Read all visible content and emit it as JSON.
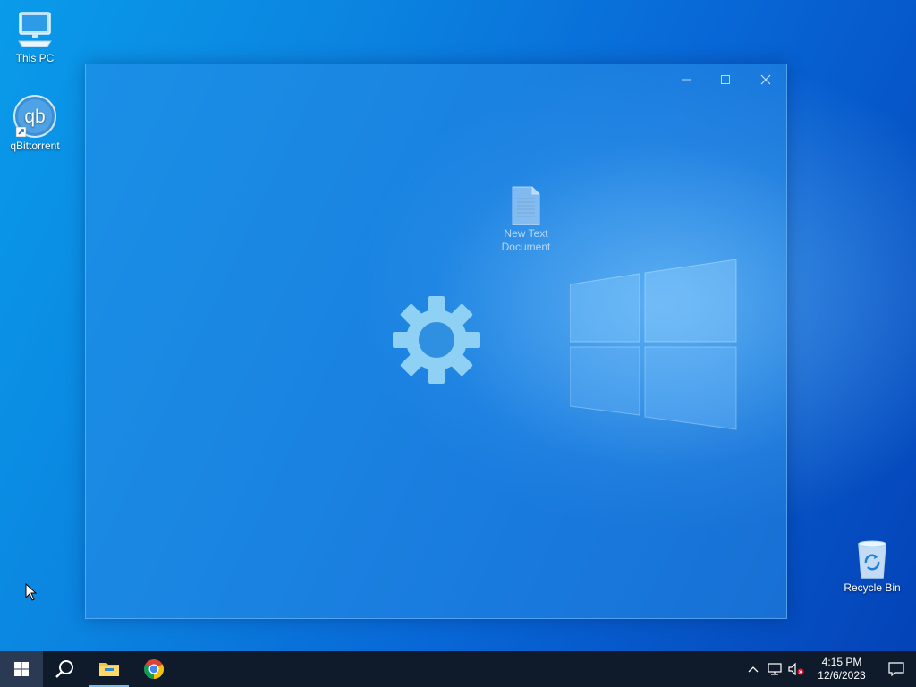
{
  "desktop": {
    "icons": {
      "this_pc": "This PC",
      "qbittorrent": "qBittorrent",
      "recycle_bin": "Recycle Bin"
    }
  },
  "window": {
    "file_label_line1": "New Text",
    "file_label_line2": "Document",
    "minimize_icon": "minimize-icon",
    "maximize_icon": "maximize-icon",
    "close_icon": "close-icon",
    "loading_icon": "gear-icon"
  },
  "taskbar": {
    "start_icon": "windows-logo-icon",
    "search_icon": "search-icon",
    "pinned": [
      "file-explorer",
      "google-chrome"
    ],
    "tray": {
      "icons": [
        "chevron-up-icon",
        "network-icon",
        "volume-muted-icon"
      ],
      "time": "4:15 PM",
      "date": "12/6/2023",
      "notification_icon": "action-center-icon"
    }
  },
  "colors": {
    "taskbar": "#0f1a2b",
    "accent": "#76b9ed"
  }
}
